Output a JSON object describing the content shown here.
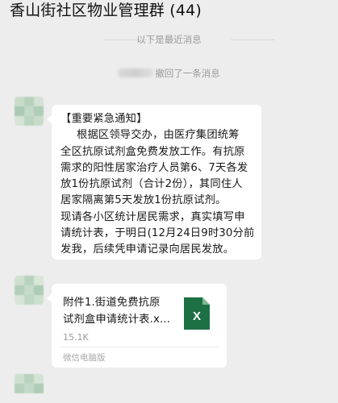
{
  "header": {
    "title": "香山街社区物业管理群 (44)"
  },
  "system_divider": {
    "text": "以下是最近消息"
  },
  "recall_notice": {
    "text": "撤回了一条消息"
  },
  "messages": [
    {
      "type": "text",
      "lines": [
        "【重要紧急通知】",
        "根据区领导交办，由医疗集团统筹",
        "全区抗原试剂盒免费发放工作。有抗原",
        "需求的阳性居家治疗人员第6、7天各发",
        "放1份抗原试剂（合计2份），其同住人",
        "居家隔离第5天发放1份抗原试剂。",
        "现请各小区统计居民需求，真实填写申",
        "请统计表，于明日(12月24日9时30分前",
        "发我，后续凭申请记录向居民发放。"
      ]
    },
    {
      "type": "file",
      "name_line1": "附件1.街道免费抗原",
      "name_line2": "试剂盒申请统计表.x...",
      "size": "15.1K",
      "source": "微信电脑版",
      "icon": "excel-file-icon",
      "icon_letter": "X",
      "icon_color": "#1d7044"
    }
  ],
  "colors": {
    "background": "#ededed",
    "bubble": "#ffffff",
    "muted_text": "#9a9a9a",
    "excel_green": "#1d7044"
  }
}
